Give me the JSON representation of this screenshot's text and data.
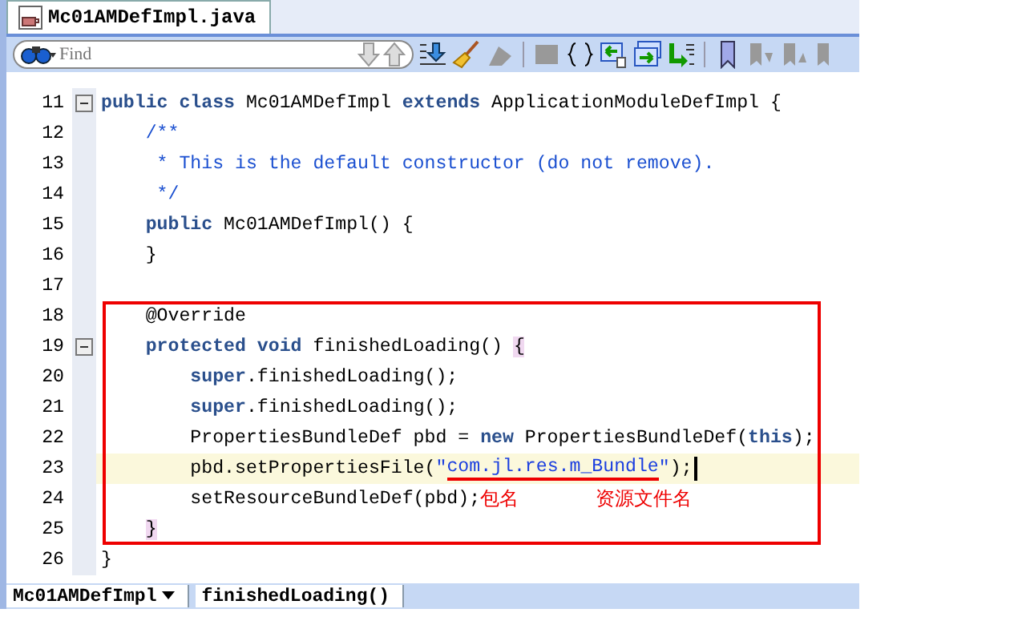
{
  "tab": {
    "title": "Mc01AMDefImpl.java",
    "selected": true
  },
  "find": {
    "placeholder": "Find"
  },
  "lines": [
    {
      "number": "11",
      "fold": true,
      "current": false,
      "tokens": [
        {
          "kind": "keyword",
          "text": "public class"
        },
        {
          "kind": "plain",
          "text": " Mc01AMDefImpl "
        },
        {
          "kind": "keyword",
          "text": "extends"
        },
        {
          "kind": "plain",
          "text": " ApplicationModuleDefImpl {"
        }
      ]
    },
    {
      "number": "12",
      "fold": false,
      "current": false,
      "tokens": [
        {
          "kind": "comment",
          "text": "    /**"
        }
      ]
    },
    {
      "number": "13",
      "fold": false,
      "current": false,
      "tokens": [
        {
          "kind": "comment",
          "text": "     * This is the default constructor (do not remove)."
        }
      ]
    },
    {
      "number": "14",
      "fold": false,
      "current": false,
      "tokens": [
        {
          "kind": "comment",
          "text": "     */"
        }
      ]
    },
    {
      "number": "15",
      "fold": false,
      "current": false,
      "tokens": [
        {
          "kind": "keyword",
          "text": "    public"
        },
        {
          "kind": "plain",
          "text": " Mc01AMDefImpl() {"
        }
      ]
    },
    {
      "number": "16",
      "fold": false,
      "current": false,
      "tokens": [
        {
          "kind": "plain",
          "text": "    }"
        }
      ]
    },
    {
      "number": "17",
      "fold": false,
      "current": false
    }
  ],
  "boxed_lines": [
    {
      "number": "18",
      "fold": false,
      "current": false,
      "tokens": [
        {
          "kind": "plain",
          "text": "    @Override"
        }
      ]
    },
    {
      "number": "19",
      "fold": true,
      "current": false,
      "tokens": [
        {
          "kind": "keyword",
          "text": "    protected void"
        },
        {
          "kind": "plain",
          "text": " finishedLoading() "
        },
        {
          "kind": "brace",
          "text": "{"
        }
      ]
    },
    {
      "number": "20",
      "fold": false,
      "current": false,
      "tokens": [
        {
          "kind": "keyword",
          "text": "        super"
        },
        {
          "kind": "plain",
          "text": ".finishedLoading();"
        }
      ]
    },
    {
      "number": "21",
      "fold": false,
      "current": false,
      "tokens": [
        {
          "kind": "keyword",
          "text": "        super"
        },
        {
          "kind": "plain",
          "text": ".finishedLoading();"
        }
      ]
    },
    {
      "number": "22",
      "fold": false,
      "current": false,
      "tokens": [
        {
          "kind": "plain",
          "text": "        PropertiesBundleDef pbd = "
        },
        {
          "kind": "keyword",
          "text": "new"
        },
        {
          "kind": "plain",
          "text": " PropertiesBundleDef("
        },
        {
          "kind": "keyword",
          "text": "this"
        },
        {
          "kind": "plain",
          "text": ");"
        }
      ]
    },
    {
      "number": "23",
      "fold": false,
      "current": true,
      "tokens": [
        {
          "kind": "plain",
          "text": "        pbd.setPropertiesFile("
        },
        {
          "kind": "string",
          "text": "\""
        },
        {
          "kind": "marked",
          "text": "com.jl.res."
        },
        {
          "kind": "marked",
          "text": "m_Bundle"
        },
        {
          "kind": "string",
          "text": "\""
        },
        {
          "kind": "plain",
          "text": ");"
        }
      ]
    },
    {
      "number": "24",
      "fold": false,
      "current": false,
      "tokens": [
        {
          "kind": "plain",
          "text": "        setResourceBundleDef(pbd);"
        },
        {
          "kind": "note",
          "text": "包名"
        },
        {
          "kind": "note-far",
          "text": "资源文件名"
        }
      ]
    },
    {
      "number": "25",
      "fold": false,
      "current": false,
      "tokens": [
        {
          "kind": "indented-brace",
          "text": "}"
        }
      ]
    }
  ],
  "after_lines": [
    {
      "number": "26",
      "fold": false,
      "current": false,
      "tokens": [
        {
          "kind": "plain",
          "text": "}"
        }
      ]
    }
  ],
  "breadcrumb": [
    "Mc01AMDefImpl",
    "finishedLoading()"
  ]
}
